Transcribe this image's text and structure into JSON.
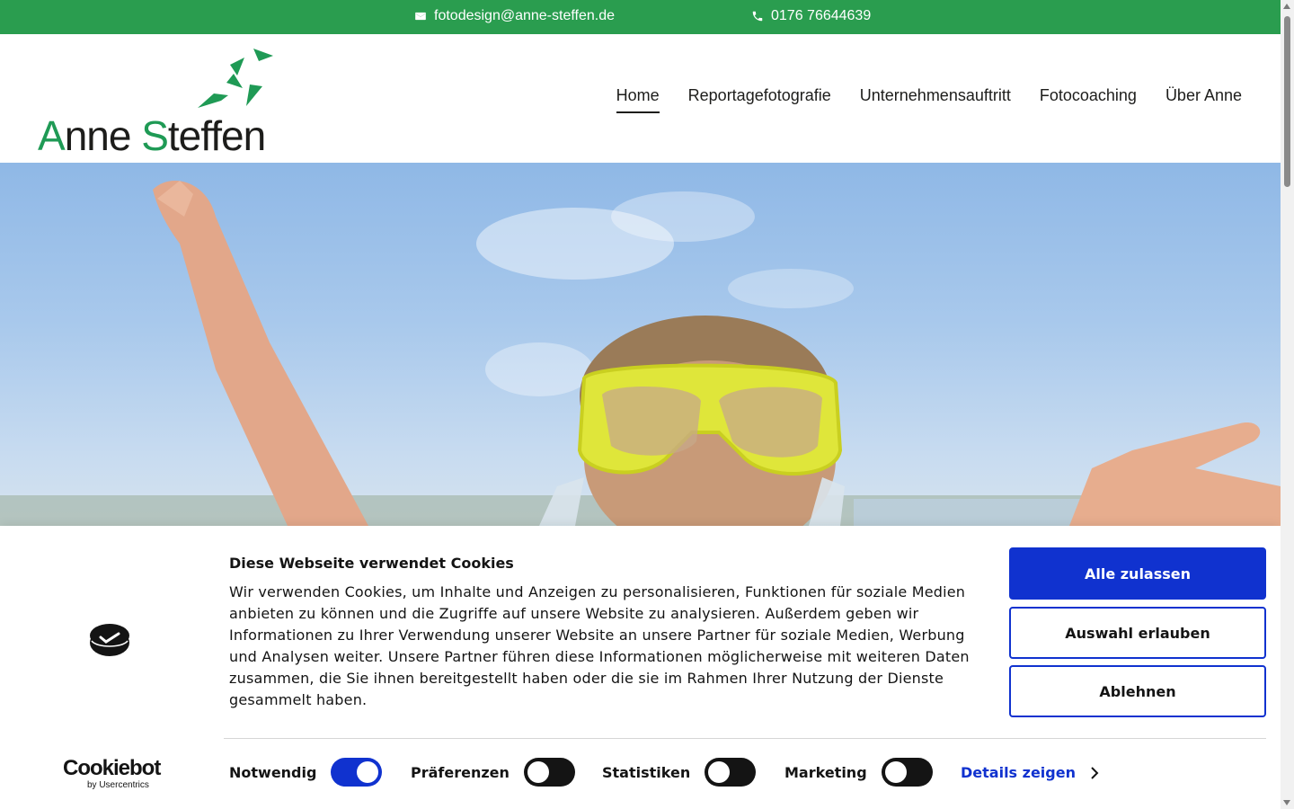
{
  "topbar": {
    "email": "fotodesign@anne-steffen.de",
    "phone": "0176 76644639",
    "email_icon": "mail-icon",
    "phone_icon": "phone-icon",
    "color": "#2a9d4f"
  },
  "logo": {
    "first_initial": "A",
    "first_rest": "nne ",
    "last_initial": "S",
    "last_rest": "teffen",
    "accent_color": "#1f9a55"
  },
  "nav": {
    "items": [
      {
        "label": "Home",
        "active": true
      },
      {
        "label": "Reportagefotografie",
        "active": false
      },
      {
        "label": "Unternehmensauftritt",
        "active": false
      },
      {
        "label": "Fotocoaching",
        "active": false
      },
      {
        "label": "Über Anne",
        "active": false
      }
    ]
  },
  "cookie": {
    "title": "Diese Webseite verwendet Cookies",
    "text": "Wir verwenden Cookies, um Inhalte und Anzeigen zu personalisieren, Funktionen für soziale Medien anbieten zu können und die Zugriffe auf unsere Website zu analysieren. Außerdem geben wir Informationen zu Ihrer Verwendung unserer Website an unsere Partner für soziale Medien, Werbung und Analysen weiter. Unsere Partner führen diese Informationen möglicherweise mit weiteren Daten zusammen, die Sie ihnen bereitgestellt haben oder die sie im Rahmen Ihrer Nutzung der Dienste gesammelt haben.",
    "buttons": {
      "allow_all": "Alle zulassen",
      "allow_selection": "Auswahl erlauben",
      "deny": "Ablehnen"
    },
    "brand": {
      "name": "Cookiebot",
      "sub": "by Usercentrics"
    },
    "toggles": [
      {
        "label": "Notwendig",
        "on": true
      },
      {
        "label": "Präferenzen",
        "on": false
      },
      {
        "label": "Statistiken",
        "on": false
      },
      {
        "label": "Marketing",
        "on": false
      }
    ],
    "details_label": "Details zeigen",
    "accent_color": "#1032cf"
  }
}
